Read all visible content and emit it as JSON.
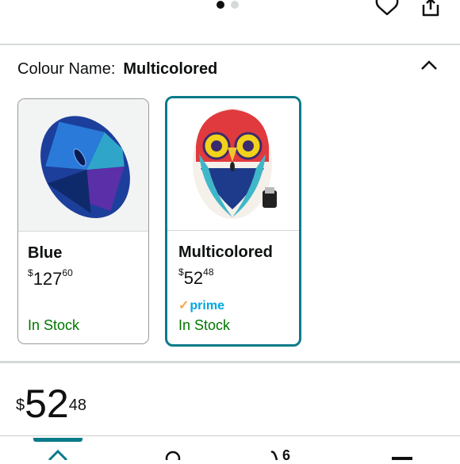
{
  "carousel": {
    "dots": 2,
    "active_index": 0
  },
  "colour": {
    "label": "Colour Name:",
    "value": "Multicolored"
  },
  "variants": [
    {
      "name": "Blue",
      "currency": "$",
      "price_whole": "127",
      "price_fraction": "60",
      "stock": "In Stock"
    },
    {
      "name": "Multicolored",
      "currency": "$",
      "price_whole": "52",
      "price_fraction": "48",
      "prime": "prime",
      "stock": "In Stock"
    }
  ],
  "price": {
    "currency": "$",
    "whole": "52",
    "fraction": "48"
  },
  "colors": {
    "accent": "#0a7b8a",
    "in_stock": "#007600",
    "prime": "#00a8e1"
  },
  "bottom_nav": {
    "items": [
      "home-icon",
      "profile-icon",
      "cart-icon",
      "menu-icon"
    ],
    "cart_count": "6"
  }
}
